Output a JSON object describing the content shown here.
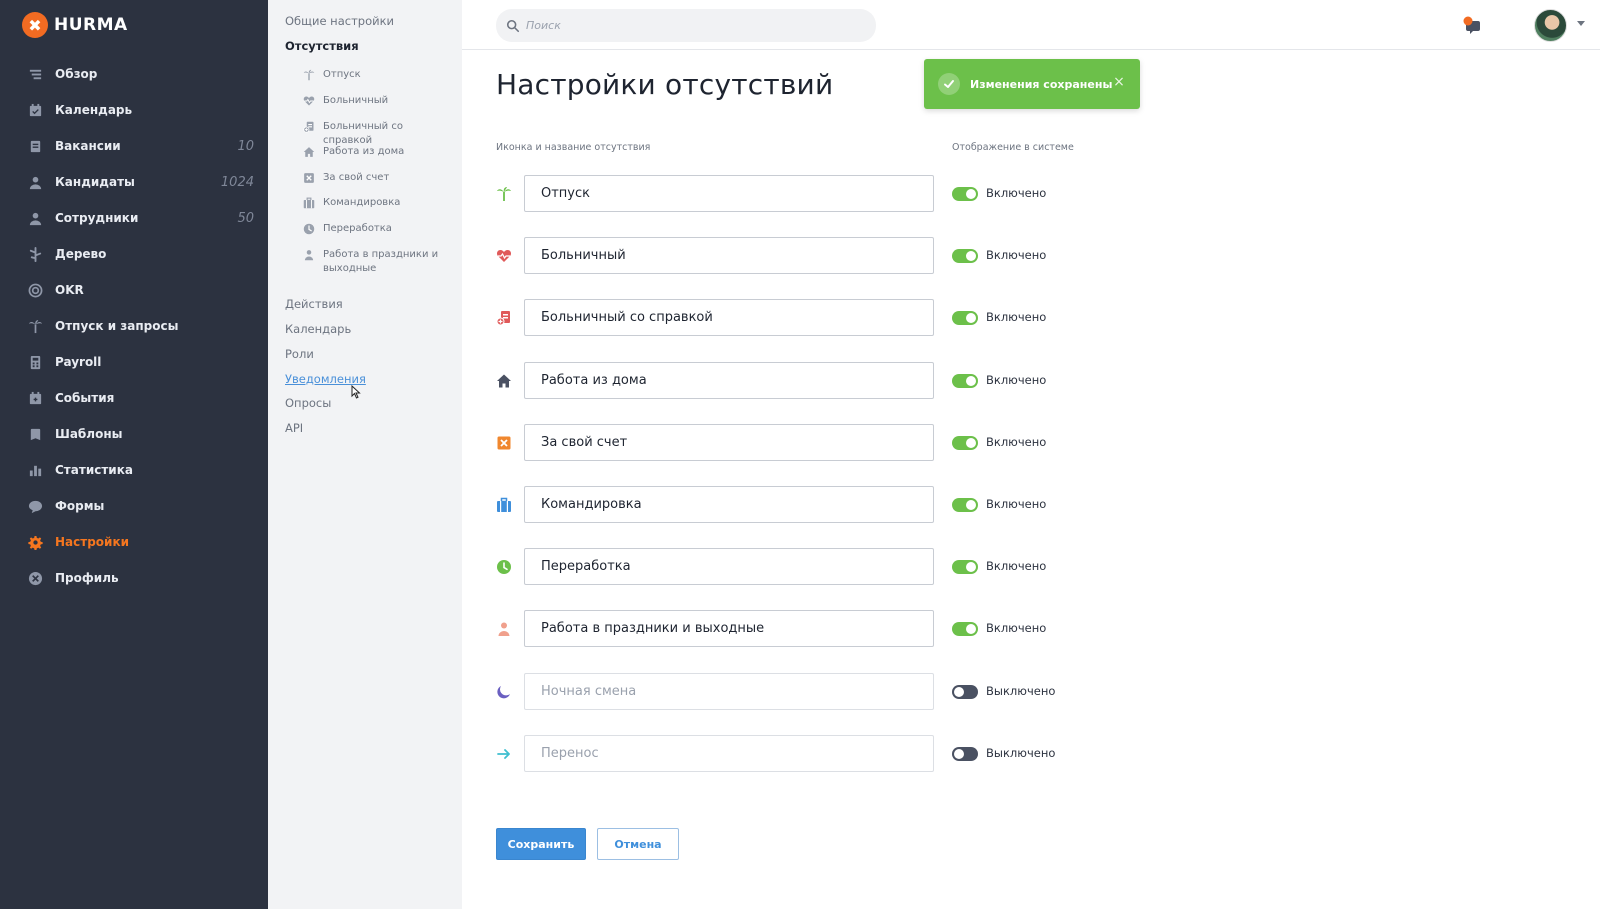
{
  "brand": {
    "logo_glyph": "✖",
    "name": "HURMA",
    "accent": "#f26b22"
  },
  "sidebar": {
    "items": [
      {
        "label": "Обзор",
        "icon": "overview-icon",
        "count": ""
      },
      {
        "label": "Календарь",
        "icon": "calendar-icon",
        "count": ""
      },
      {
        "label": "Вакансии",
        "icon": "vacancies-icon",
        "count": "10"
      },
      {
        "label": "Кандидаты",
        "icon": "candidates-icon",
        "count": "1024"
      },
      {
        "label": "Сотрудники",
        "icon": "employees-icon",
        "count": "50"
      },
      {
        "label": "Дерево",
        "icon": "tree-icon",
        "count": ""
      },
      {
        "label": "OKR",
        "icon": "target-icon",
        "count": ""
      },
      {
        "label": "Отпуск и запросы",
        "icon": "palm-icon",
        "count": ""
      },
      {
        "label": "Payroll",
        "icon": "calculator-icon",
        "count": ""
      },
      {
        "label": "События",
        "icon": "events-icon",
        "count": ""
      },
      {
        "label": "Шаблоны",
        "icon": "templates-icon",
        "count": ""
      },
      {
        "label": "Статистика",
        "icon": "stats-icon",
        "count": ""
      },
      {
        "label": "Формы",
        "icon": "forms-icon",
        "count": ""
      },
      {
        "label": "Настройки",
        "icon": "gear-icon",
        "count": "",
        "active": true
      },
      {
        "label": "Профиль",
        "icon": "profile-icon",
        "count": ""
      }
    ]
  },
  "subnav": {
    "general": "Общие настройки",
    "absences": "Отсутствия",
    "absence_items": [
      "Отпуск",
      "Больничный",
      "Больничный со справкой",
      "Работа из дома",
      "За свой счет",
      "Командировка",
      "Переработка",
      "Работа в праздники и выходные"
    ],
    "actions": "Действия",
    "calendar": "Календарь",
    "roles": "Роли",
    "notifications": "Уведомления",
    "surveys": "Опросы",
    "api": "API"
  },
  "search": {
    "placeholder": "Поиск"
  },
  "page": {
    "title": "Настройки отсутствий",
    "col_name": "Иконка и название отсутствия",
    "col_display": "Отображение в системе",
    "rows": [
      {
        "value": "Отпуск",
        "placeholder": "",
        "enabled": true,
        "status": "Включено",
        "icon": "palm-icon",
        "icon_color": "#6cc04a"
      },
      {
        "value": "Больничный",
        "placeholder": "",
        "enabled": true,
        "status": "Включено",
        "icon": "heart-pulse-icon",
        "icon_color": "#e05a5a"
      },
      {
        "value": "Больничный со справкой",
        "placeholder": "",
        "enabled": true,
        "status": "Включено",
        "icon": "medical-note-icon",
        "icon_color": "#e05a5a"
      },
      {
        "value": "Работа из дома",
        "placeholder": "",
        "enabled": true,
        "status": "Включено",
        "icon": "home-icon",
        "icon_color": "#4a5162"
      },
      {
        "value": "За свой счет",
        "placeholder": "",
        "enabled": true,
        "status": "Включено",
        "icon": "cross-box-icon",
        "icon_color": "#f0872e"
      },
      {
        "value": "Командировка",
        "placeholder": "",
        "enabled": true,
        "status": "Включено",
        "icon": "briefcase-icon",
        "icon_color": "#3f8fdb"
      },
      {
        "value": "Переработка",
        "placeholder": "",
        "enabled": true,
        "status": "Включено",
        "icon": "clock-icon",
        "icon_color": "#6cc04a"
      },
      {
        "value": "Работа в праздники и выходные",
        "placeholder": "",
        "enabled": true,
        "status": "Включено",
        "icon": "person-icon",
        "icon_color": "#f0a08c"
      },
      {
        "value": "",
        "placeholder": "Ночная смена",
        "enabled": false,
        "status": "Выключено",
        "icon": "moon-icon",
        "icon_color": "#6a5fc1"
      },
      {
        "value": "",
        "placeholder": "Перенос",
        "enabled": false,
        "status": "Выключено",
        "icon": "arrow-right-icon",
        "icon_color": "#3fbfcf"
      }
    ]
  },
  "toast": {
    "text": "Изменения сохранены",
    "close": "×",
    "color": "#6cc04a"
  },
  "buttons": {
    "save": "Сохранить",
    "cancel": "Отмена",
    "primary_color": "#3f8fdb"
  }
}
